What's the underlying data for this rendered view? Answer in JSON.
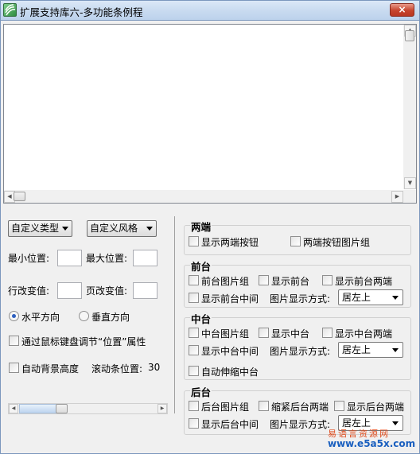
{
  "window": {
    "title": "扩展支持库六-多功能条例程",
    "close_label": "×"
  },
  "left_panel": {
    "custom_type_label": "自定义类型",
    "custom_style_label": "自定义风格",
    "min_pos_label": "最小位置:",
    "max_pos_label": "最大位置:",
    "line_step_label": "行改变值:",
    "page_step_label": "页改变值:",
    "horizontal_label": "水平方向",
    "vertical_label": "垂直方向",
    "horizontal_selected": true,
    "keyboard_label": "通过鼠标键盘调节“位置”属性",
    "auto_bg_label": "自动背景高度",
    "scroll_pos_label": "滚动条位置:",
    "scroll_pos_value": "30"
  },
  "groups": {
    "ends": {
      "title": "两端",
      "show_end_buttons": "显示两端按钮",
      "end_button_images": "两端按钮图片组"
    },
    "front": {
      "title": "前台",
      "image_group": "前台图片组",
      "show": "显示前台",
      "show_ends": "显示前台两端",
      "show_middle": "显示前台中间",
      "display_mode_label": "图片显示方式:",
      "display_mode_value": "居左上"
    },
    "middle": {
      "title": "中台",
      "image_group": "中台图片组",
      "show": "显示中台",
      "show_ends": "显示中台两端",
      "show_middle": "显示中台中间",
      "display_mode_label": "图片显示方式:",
      "display_mode_value": "居左上",
      "auto_stretch": "自动伸缩中台"
    },
    "back": {
      "title": "后台",
      "image_group": "后台图片组",
      "shrink_ends": "缩紧后台两端",
      "show_ends": "显示后台两端",
      "show_middle": "显示后台中间",
      "display_mode_label": "图片显示方式:",
      "display_mode_value": "居左上"
    }
  },
  "watermark": {
    "line1": "易语言资源网",
    "line2": "www.e5a5x.com"
  },
  "colors": {
    "title_bar": "#c9dbf0",
    "close_button": "#c6442d",
    "window_body": "#f0f0f0"
  }
}
